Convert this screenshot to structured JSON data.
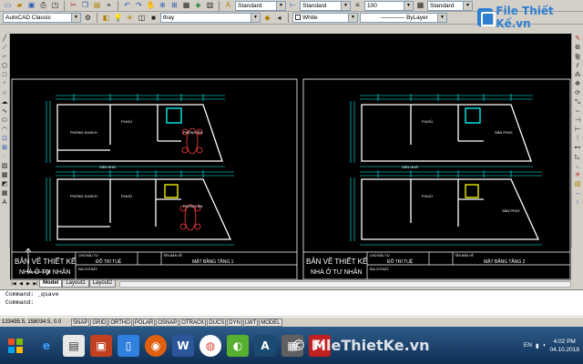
{
  "toolbar1": {
    "workspace": "AutoCAD Classic",
    "text_style": "Standard",
    "dim_style": "Standard",
    "lineweight_value": "100",
    "table_style": "Standard"
  },
  "toolbar2": {
    "layer": "thay",
    "color": "White",
    "linetype": "ByLayer"
  },
  "logo": {
    "text": "File Thiết Kế.vn"
  },
  "drawings": [
    {
      "title_line1": "BẢN VẼ THIẾT KẾ",
      "title_line2": "NHÀ Ở TƯ NHÂN",
      "owner_label": "CHỦ ĐẦU TƯ",
      "owner": "ĐỖ TRÍ TUỆ",
      "sheet_label": "TÊN BẢN VẼ",
      "sheet": "MẶT BẰNG TẦNG 1",
      "address_label": "ĐỊA CHỈ ĐẤT:",
      "rooms": {
        "top_living": "PHÒNG KHÁCH",
        "top_bed": "P.NGỦ",
        "top_wc": "PHÒNG ĂN",
        "yard": "SÂN NHÀ",
        "bottom_living": "PHÒNG KHÁCH",
        "bottom_bed": "P.NGỦ",
        "bottom_wc": "PHÒNG ĂN"
      }
    },
    {
      "title_line1": "BẢN VẼ THIẾT KẾ",
      "title_line2": "NHÀ Ở TƯ NHÂN",
      "owner_label": "CHỦ ĐẦU TƯ",
      "owner": "ĐỖ TRÍ TUỆ",
      "sheet_label": "TÊN BẢN VẼ",
      "sheet": "MẶT BẰNG TẦNG 2",
      "address_label": "ĐỊA CHỈ ĐẤT:",
      "rooms": {
        "top_living": "",
        "top_bed": "P.NGỦ",
        "top_wc": "SÂN PHƠI",
        "yard": "SÂN NHÀ",
        "bottom_living": "",
        "bottom_bed": "P.NGỦ",
        "bottom_wc": "SÂN PHƠI"
      }
    }
  ],
  "tabs": [
    "Model",
    "Layout1",
    "Layout2"
  ],
  "command": {
    "line1": "Command: _qsave",
    "line2": "Command:"
  },
  "status": {
    "coords": "133495.5, 158034.5, 0.0",
    "modes": [
      "SNAP",
      "GRID",
      "ORTHO",
      "POLAR",
      "OSNAP",
      "OTRACK",
      "DUCS",
      "DYN",
      "LWT",
      "MODEL"
    ]
  },
  "taskbar": {
    "lang": "EN",
    "time": "4:02 PM",
    "date": "04.10.2018",
    "watermark": "© FileThietKe.vn"
  },
  "colors": {
    "canvas": "#000000",
    "walls": "#ffffff",
    "dims": "#00ffff",
    "accent": "#ff0000",
    "stairs": "#ffff00"
  }
}
